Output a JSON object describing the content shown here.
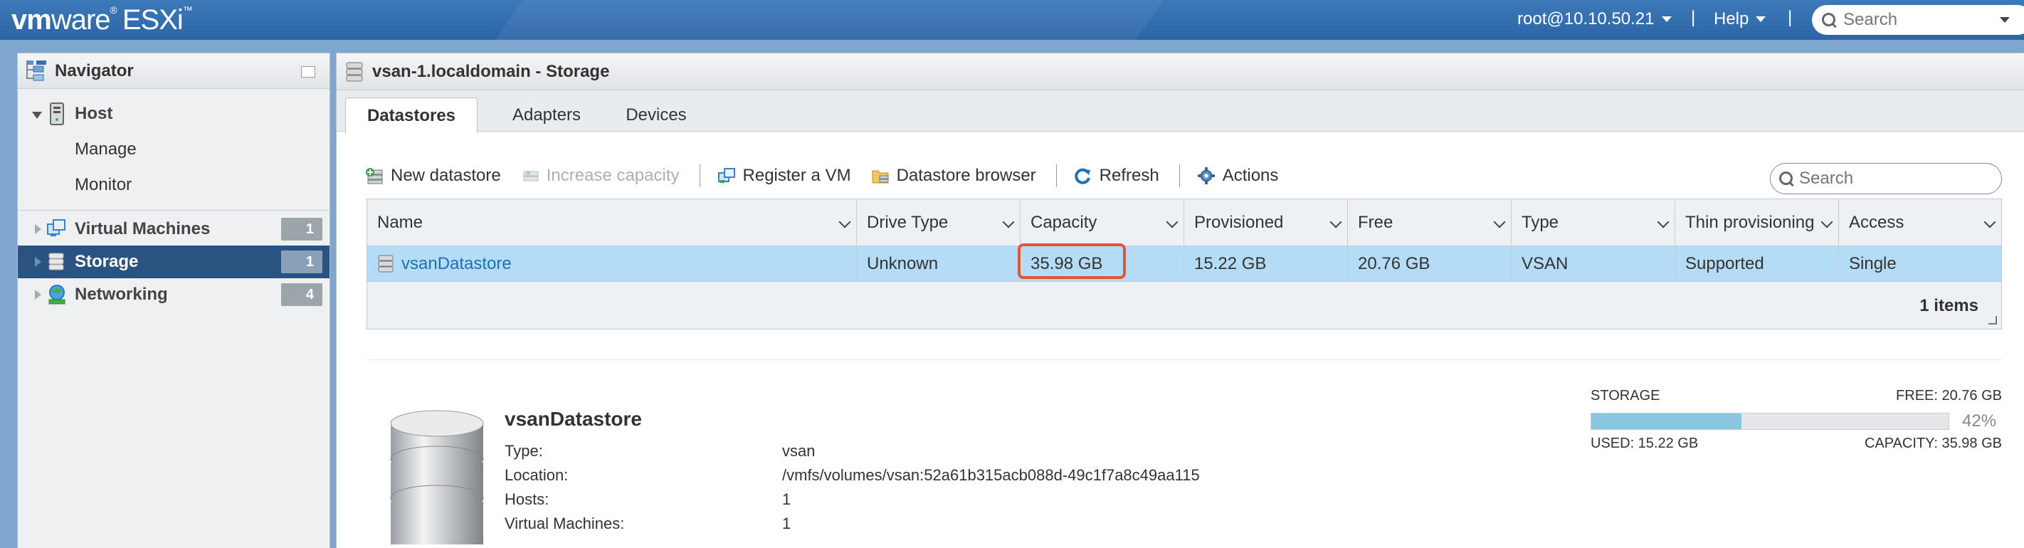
{
  "topbar": {
    "logo_vm": "vm",
    "logo_ware": "ware",
    "logo_reg": "®",
    "logo_product": "ESXi",
    "logo_tm": "™",
    "user": "root@10.10.50.21",
    "help": "Help",
    "separator": "|",
    "search_placeholder": "Search"
  },
  "navigator": {
    "title": "Navigator",
    "host": "Host",
    "manage": "Manage",
    "monitor": "Monitor",
    "items": [
      {
        "label": "Virtual Machines",
        "count": "1"
      },
      {
        "label": "Storage",
        "count": "1"
      },
      {
        "label": "Networking",
        "count": "4"
      }
    ]
  },
  "main": {
    "title": "vsan-1.localdomain - Storage",
    "tabs": [
      "Datastores",
      "Adapters",
      "Devices"
    ],
    "toolbar": {
      "new_datastore": "New datastore",
      "increase_capacity": "Increase capacity",
      "register_vm": "Register a VM",
      "datastore_browser": "Datastore browser",
      "refresh": "Refresh",
      "actions": "Actions"
    },
    "search_placeholder": "Search"
  },
  "table": {
    "columns": [
      "Name",
      "Drive Type",
      "Capacity",
      "Provisioned",
      "Free",
      "Type",
      "Thin provisioning",
      "Access"
    ],
    "rows": [
      [
        "vsanDatastore",
        "Unknown",
        "35.98 GB",
        "15.22 GB",
        "20.76 GB",
        "VSAN",
        "Supported",
        "Single"
      ]
    ],
    "footer": "1 items"
  },
  "details": {
    "name": "vsanDatastore",
    "props": [
      {
        "label": "Type:",
        "value": "vsan"
      },
      {
        "label": "Location:",
        "value": "/vmfs/volumes/vsan:52a61b315acb088d-49c1f7a8c49aa115"
      },
      {
        "label": "Hosts:",
        "value": "1"
      },
      {
        "label": "Virtual Machines:",
        "value": "1"
      }
    ],
    "storage": {
      "label": "STORAGE",
      "free": "FREE: 20.76 GB",
      "percent": "42%",
      "used_fraction": 0.42,
      "used": "USED: 15.22 GB",
      "capacity": "CAPACITY: 35.98 GB"
    }
  },
  "colors": {
    "selected_nav": "#2b5382",
    "selected_row": "#b4dcf6",
    "highlight_box": "#e4572e",
    "storage_fill": "#8ac6e0"
  }
}
